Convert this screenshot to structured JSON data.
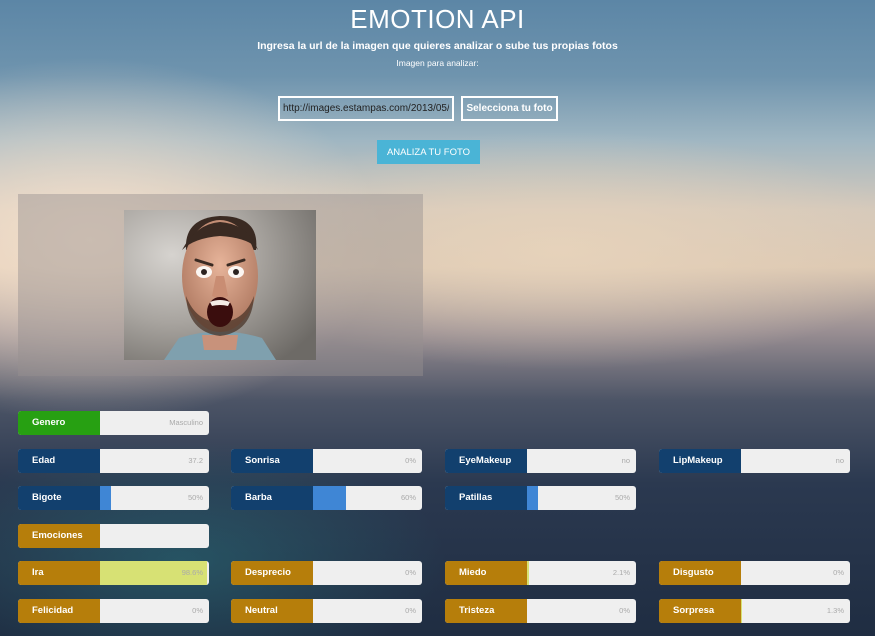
{
  "header": {
    "title": "EMOTION API",
    "subtitle": "Ingresa la url de la imagen que quieres analizar o sube tus propias fotos",
    "image_label": "Imagen para analizar:"
  },
  "form": {
    "url_value": "http://images.estampas.com/2013/05/",
    "file_button_label": "Selecciona tu foto",
    "analyze_button_label": "ANALIZA TU FOTO"
  },
  "results": {
    "genero": {
      "label": "Genero",
      "value": "Masculino"
    },
    "edad": {
      "label": "Edad",
      "value": "37.2"
    },
    "sonrisa": {
      "label": "Sonrisa",
      "value": "0%",
      "fraction": 0.0
    },
    "eyemakeup": {
      "label": "EyeMakeup",
      "value": "no"
    },
    "lipmakeup": {
      "label": "LipMakeup",
      "value": "no"
    },
    "bigote": {
      "label": "Bigote",
      "value": "50%",
      "fraction": 0.1
    },
    "barba": {
      "label": "Barba",
      "value": "60%",
      "fraction": 0.3
    },
    "patillas": {
      "label": "Patillas",
      "value": "50%",
      "fraction": 0.1
    },
    "emociones_label": "Emociones",
    "emotions": {
      "ira": {
        "label": "Ira",
        "value": "98.6%",
        "fraction": 0.986
      },
      "desprecio": {
        "label": "Desprecio",
        "value": "0%",
        "fraction": 0.0
      },
      "miedo": {
        "label": "Miedo",
        "value": "2.1%",
        "fraction": 0.021
      },
      "disgusto": {
        "label": "Disgusto",
        "value": "0%",
        "fraction": 0.0
      },
      "felicidad": {
        "label": "Felicidad",
        "value": "0%",
        "fraction": 0.0
      },
      "neutral": {
        "label": "Neutral",
        "value": "0%",
        "fraction": 0.0
      },
      "tristeza": {
        "label": "Tristeza",
        "value": "0%",
        "fraction": 0.0
      },
      "sorpresa": {
        "label": "Sorpresa",
        "value": "1.3%",
        "fraction": 0.013
      }
    }
  },
  "colors": {
    "accent_button": "#4ab4d6",
    "label_blue": "#12406e",
    "bar_blue": "#3f86d5",
    "label_green": "#27a012",
    "label_amber": "#b67e0b",
    "bar_emotion": "#d7e174"
  }
}
